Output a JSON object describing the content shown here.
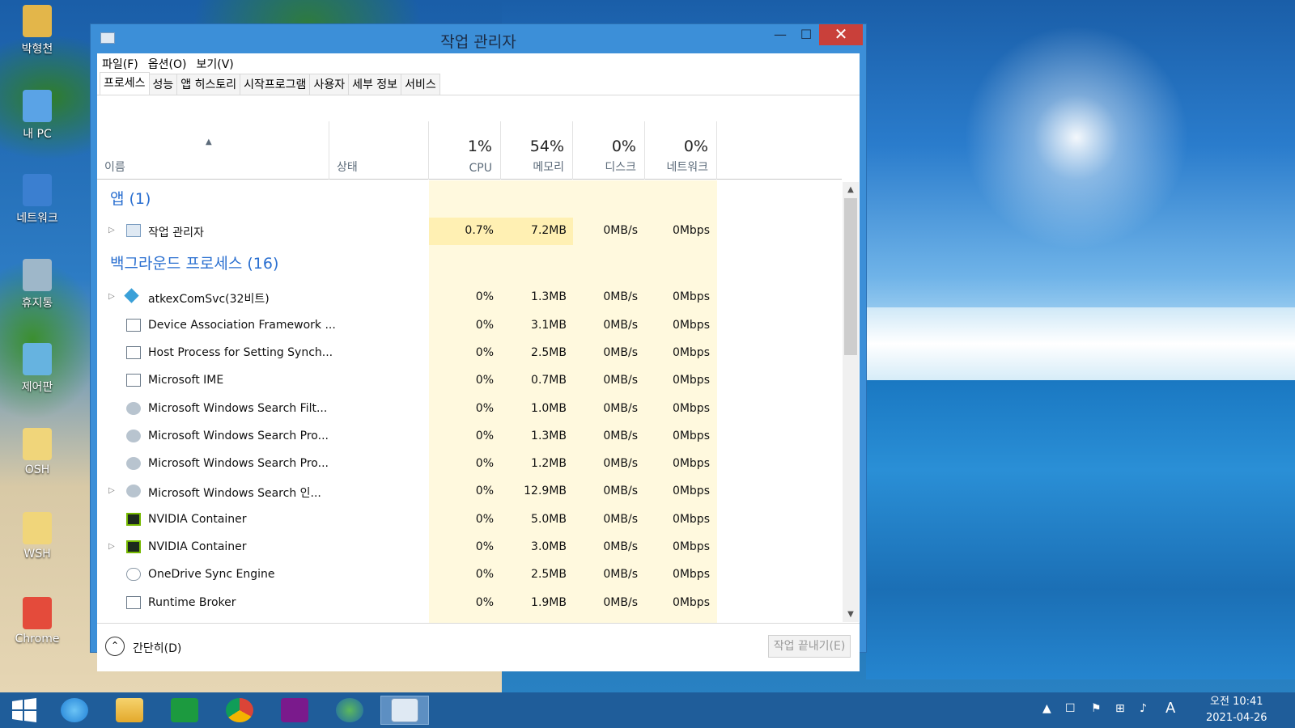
{
  "desktop": {
    "icons": [
      {
        "label": "박형천",
        "color": "#e3b64a"
      },
      {
        "label": "내 PC",
        "color": "#5aa3e6"
      },
      {
        "label": "네트워크",
        "color": "#3b7fd0"
      },
      {
        "label": "휴지통",
        "color": "#9eb7c9"
      },
      {
        "label": "제어판",
        "color": "#66b3e0"
      },
      {
        "label": "OSH",
        "color": "#f0d57a"
      },
      {
        "label": "WSH",
        "color": "#f0d57a"
      },
      {
        "label": "Chrome",
        "color": "#e44b3b"
      }
    ]
  },
  "window": {
    "title": "작업 관리자",
    "minimize": "—",
    "maximize": "☐",
    "close": "✕",
    "menu": [
      "파일(F)",
      "옵션(O)",
      "보기(V)"
    ],
    "tabs": [
      "프로세스",
      "성능",
      "앱 히스토리",
      "시작프로그램",
      "사용자",
      "세부 정보",
      "서비스"
    ],
    "active_tab": 0,
    "columns": {
      "name": "이름",
      "status": "상태",
      "cpu": {
        "pct": "1%",
        "label": "CPU"
      },
      "memory": {
        "pct": "54%",
        "label": "메모리"
      },
      "disk": {
        "pct": "0%",
        "label": "디스크"
      },
      "network": {
        "pct": "0%",
        "label": "네트워크"
      }
    },
    "groups": [
      {
        "title": "앱 (1)",
        "rows": [
          {
            "name": "작업 관리자",
            "cpu": "0.7%",
            "mem": "7.2MB",
            "disk": "0MB/s",
            "net": "0Mbps",
            "expand": true,
            "icon": "task-manager-icon"
          }
        ]
      },
      {
        "title": "백그라운드 프로세스 (16)",
        "rows": [
          {
            "name": "atkexComSvc(32비트)",
            "cpu": "0%",
            "mem": "1.3MB",
            "disk": "0MB/s",
            "net": "0Mbps",
            "expand": true,
            "icon": "service-icon"
          },
          {
            "name": "Device Association Framework ...",
            "cpu": "0%",
            "mem": "3.1MB",
            "disk": "0MB/s",
            "net": "0Mbps",
            "expand": false,
            "icon": "process-icon"
          },
          {
            "name": "Host Process for Setting Synch...",
            "cpu": "0%",
            "mem": "2.5MB",
            "disk": "0MB/s",
            "net": "0Mbps",
            "expand": false,
            "icon": "process-icon"
          },
          {
            "name": "Microsoft IME",
            "cpu": "0%",
            "mem": "0.7MB",
            "disk": "0MB/s",
            "net": "0Mbps",
            "expand": false,
            "icon": "process-icon"
          },
          {
            "name": "Microsoft Windows Search Filt...",
            "cpu": "0%",
            "mem": "1.0MB",
            "disk": "0MB/s",
            "net": "0Mbps",
            "expand": false,
            "icon": "search-service-icon"
          },
          {
            "name": "Microsoft Windows Search Pro...",
            "cpu": "0%",
            "mem": "1.3MB",
            "disk": "0MB/s",
            "net": "0Mbps",
            "expand": false,
            "icon": "search-service-icon"
          },
          {
            "name": "Microsoft Windows Search Pro...",
            "cpu": "0%",
            "mem": "1.2MB",
            "disk": "0MB/s",
            "net": "0Mbps",
            "expand": false,
            "icon": "search-service-icon"
          },
          {
            "name": "Microsoft Windows Search 인...",
            "cpu": "0%",
            "mem": "12.9MB",
            "disk": "0MB/s",
            "net": "0Mbps",
            "expand": true,
            "icon": "search-service-icon"
          },
          {
            "name": "NVIDIA Container",
            "cpu": "0%",
            "mem": "5.0MB",
            "disk": "0MB/s",
            "net": "0Mbps",
            "expand": false,
            "icon": "nvidia-icon"
          },
          {
            "name": "NVIDIA Container",
            "cpu": "0%",
            "mem": "3.0MB",
            "disk": "0MB/s",
            "net": "0Mbps",
            "expand": true,
            "icon": "nvidia-icon"
          },
          {
            "name": "OneDrive Sync Engine",
            "cpu": "0%",
            "mem": "2.5MB",
            "disk": "0MB/s",
            "net": "0Mbps",
            "expand": false,
            "icon": "onedrive-icon"
          },
          {
            "name": "Runtime Broker",
            "cpu": "0%",
            "mem": "1.9MB",
            "disk": "0MB/s",
            "net": "0Mbps",
            "expand": false,
            "icon": "process-icon"
          }
        ]
      }
    ],
    "footer": {
      "fewer_details": "간단히(D)",
      "end_task": "작업 끝내기(E)"
    }
  },
  "taskbar": {
    "apps": [
      "start-icon",
      "internet-explorer-icon",
      "file-explorer-icon",
      "store-icon",
      "chrome-icon",
      "app-i-icon",
      "network-globe-icon",
      "task-manager-icon"
    ],
    "tray_ime": "A",
    "clock_time": "오전 10:41",
    "clock_date": "2021-04-26"
  },
  "colors": {
    "accent": "#3c8fd8",
    "group_title": "#2a6fd0",
    "heat_light": "#fff9de",
    "heat_medium": "#fff0b3",
    "close_button": "#c9403a"
  }
}
